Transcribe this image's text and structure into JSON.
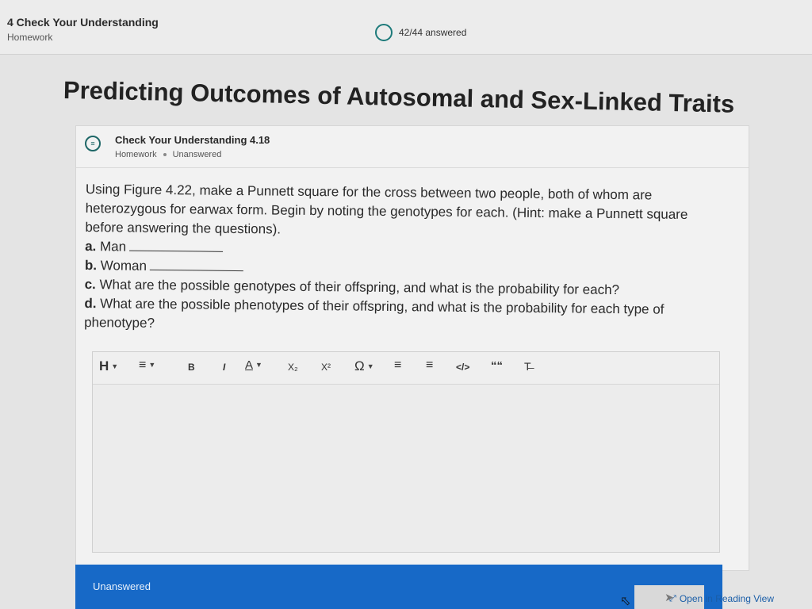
{
  "header": {
    "assignment_title": "4 Check Your Understanding",
    "assignment_type": "Homework",
    "progress_text": "42/44 answered"
  },
  "page": {
    "title": "Predicting Outcomes of Autosomal and Sex-Linked Traits"
  },
  "card": {
    "title": "Check Your Understanding 4.18",
    "meta_type": "Homework",
    "meta_status": "Unanswered"
  },
  "question": {
    "prompt": "Using Figure 4.22, make a Punnett square for the cross between two people, both of whom are heterozygous for earwax form. Begin by noting the genotypes for each. (Hint: make a Punnett square before answering the questions).",
    "a_label": "a.",
    "a_text": "Man",
    "b_label": "b.",
    "b_text": "Woman",
    "c_label": "c.",
    "c_text": "What are the possible genotypes of their offspring, and what is the probability for each?",
    "d_label": "d.",
    "d_text": "What are the possible phenotypes of their offspring, and what is the probability for each type of phenotype?"
  },
  "toolbar": {
    "heading": "H",
    "bold": "B",
    "italic": "I",
    "text_color": "A",
    "subscript": "X₂",
    "superscript": "X²",
    "special_char": "Ω",
    "code": "</>",
    "quote": "““",
    "clear_format": "T̶"
  },
  "footer": {
    "status": "Unanswered",
    "open_reading_view": "Open in Reading View"
  },
  "colors": {
    "accent_blue": "#1769c7",
    "progress_teal": "#1d7a7a",
    "link_blue": "#1a5ea8"
  }
}
